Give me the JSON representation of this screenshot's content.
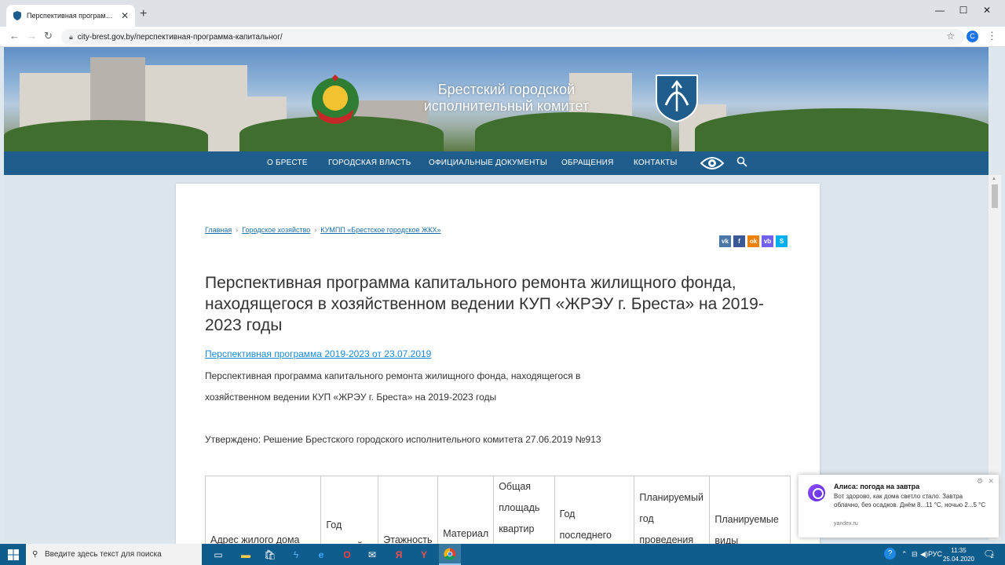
{
  "browser": {
    "tab_title": "Перспективная программа капитальн",
    "tab_close": "✕",
    "new_tab": "+",
    "url": "city-brest.gov.by/перспективная-программа-капитальног/",
    "profile_initial": "C",
    "window_controls": [
      "—",
      "☐",
      "✕"
    ]
  },
  "header": {
    "title_line1": "Брестский городской",
    "title_line2": "исполнительный комитет",
    "nav": [
      "О БРЕСТЕ",
      "ГОРОДСКАЯ ВЛАСТЬ",
      "ОФИЦИАЛЬНЫЕ ДОКУМЕНТЫ",
      "ОБРАЩЕНИЯ",
      "КОНТАКТЫ"
    ]
  },
  "breadcrumbs": [
    "Главная",
    "Городское хозяйство",
    "КУМПП «Брестское городское ЖКХ»"
  ],
  "share_buttons": [
    {
      "label": "vk",
      "color": "#4a76a8"
    },
    {
      "label": "f",
      "color": "#3b5998"
    },
    {
      "label": "ok",
      "color": "#ee8208"
    },
    {
      "label": "vb",
      "color": "#7360f2"
    },
    {
      "label": "S",
      "color": "#00aff0"
    }
  ],
  "page": {
    "title": "Перспективная программа капитального ремонта жилищного фонда, находящегося в хозяйственном ведении КУП «ЖРЭУ г. Бреста» на 2019-2023 годы",
    "doc_link": "Перспективная программа 2019-2023 от 23.07.2019",
    "para1": "Перспективная программа капитального ремонта жилищного фонда, находящегося в",
    "para2": "хозяйственном ведении КУП «ЖРЭУ г. Бреста» на 2019-2023 годы",
    "approved": "Утверждено: Решение Брестского городского исполнительного комитета 27.06.2019 №913"
  },
  "table": {
    "headers": [
      "Адрес жилого дома",
      "Год постройки",
      "Этажность",
      "Материал",
      "Общая площадь квартир жилых",
      "Год последнего",
      "Планируемый год проведения",
      "Планируемые виды"
    ]
  },
  "notification": {
    "title": "Алиса: погода на завтра",
    "body": "Вот здорово, как дома светло стало. Завтра облачно, без осадков. Днём 8...11 °C, ночью 2...5 °C",
    "source": "yandex.ru",
    "close": "✕",
    "settings": "⚙"
  },
  "taskbar": {
    "search_placeholder": "Введите здесь текст для поиска",
    "language": "РУС",
    "time": "11:35",
    "date": "25.04.2020",
    "notifications_count": "2"
  },
  "colors": {
    "nav_bg": "#1f5d8c",
    "link": "#1c8ad6",
    "taskbar": "#0f5d8c"
  }
}
